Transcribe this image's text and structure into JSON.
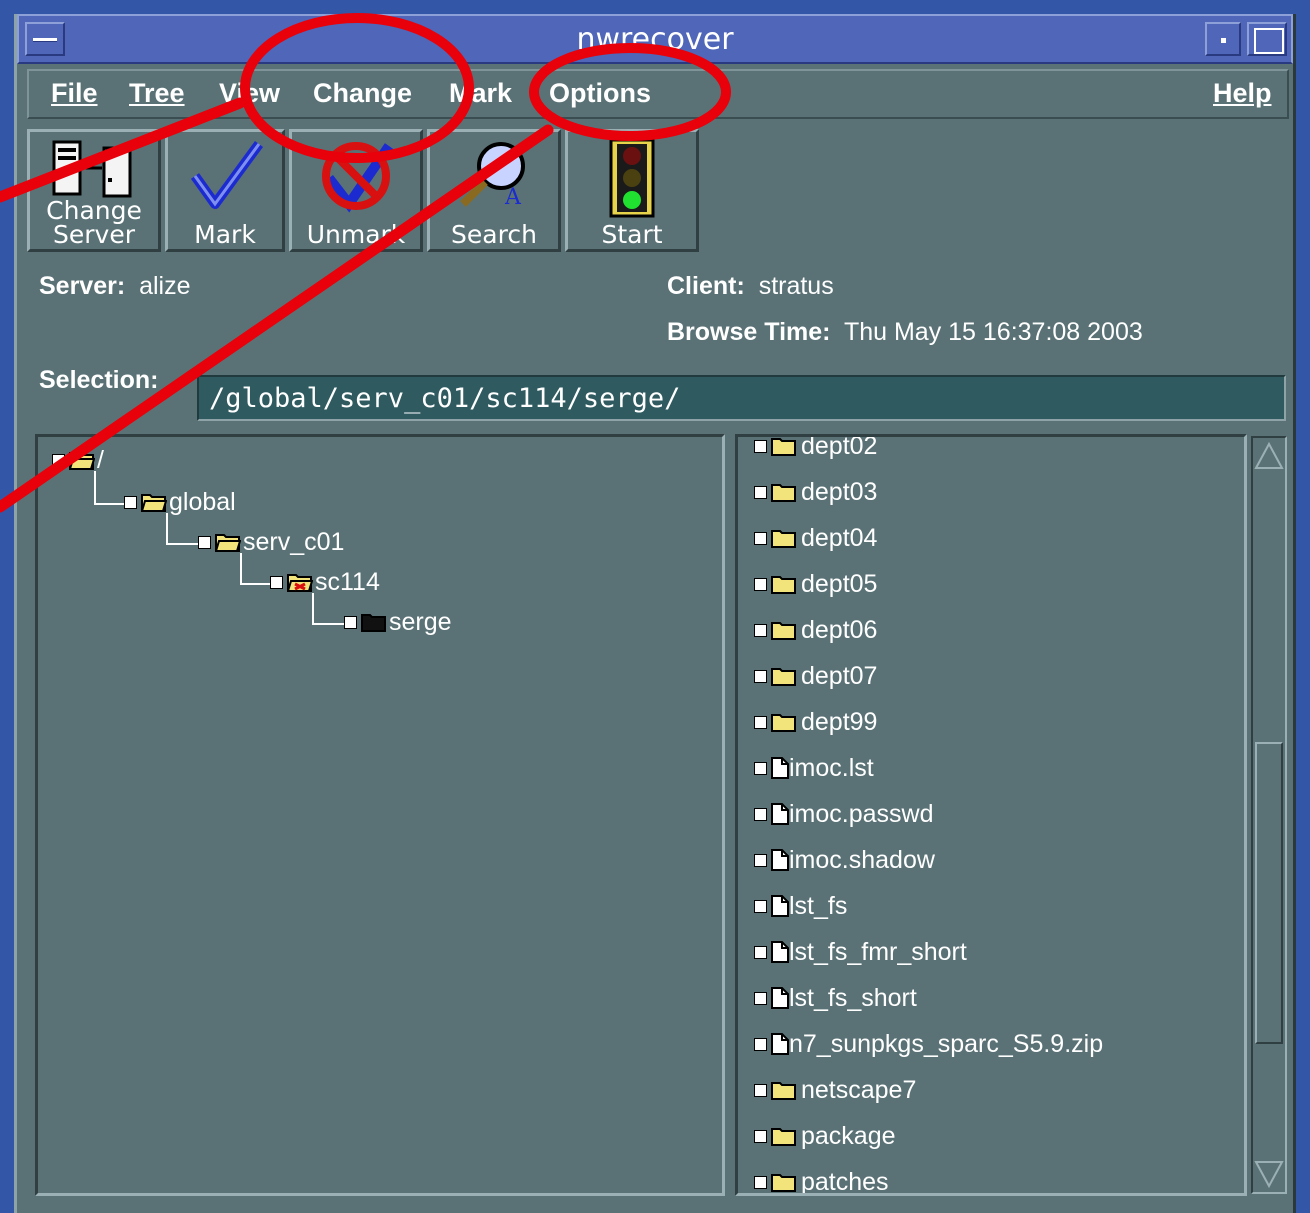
{
  "window": {
    "title": "nwrecover"
  },
  "menubar": {
    "file": "File",
    "tree": "Tree",
    "view": "View",
    "change": "Change",
    "mark": "Mark",
    "options": "Options",
    "help": "Help"
  },
  "toolbar": {
    "change_server_l1": "Change",
    "change_server_l2": "Server",
    "mark": "Mark",
    "unmark": "Unmark",
    "search": "Search",
    "start": "Start"
  },
  "info": {
    "server_label": "Server:",
    "server_value": "alize",
    "client_label": "Client:",
    "client_value": "stratus",
    "browse_label": "Browse Time:",
    "browse_value": "Thu May 15 16:37:08 2003",
    "selection_label": "Selection:",
    "selection_value": "/global/serv_c01/sc114/serge/"
  },
  "tree": [
    "/",
    "global",
    "serv_c01",
    "sc114",
    "serge"
  ],
  "files": [
    {
      "name": "dept02",
      "type": "folder"
    },
    {
      "name": "dept03",
      "type": "folder"
    },
    {
      "name": "dept04",
      "type": "folder"
    },
    {
      "name": "dept05",
      "type": "folder"
    },
    {
      "name": "dept06",
      "type": "folder"
    },
    {
      "name": "dept07",
      "type": "folder"
    },
    {
      "name": "dept99",
      "type": "folder"
    },
    {
      "name": "imoc.lst",
      "type": "file"
    },
    {
      "name": "imoc.passwd",
      "type": "file"
    },
    {
      "name": "imoc.shadow",
      "type": "file"
    },
    {
      "name": "lst_fs",
      "type": "file"
    },
    {
      "name": "lst_fs_fmr_short",
      "type": "file"
    },
    {
      "name": "lst_fs_short",
      "type": "file"
    },
    {
      "name": "n7_sunpkgs_sparc_S5.9.zip",
      "type": "file"
    },
    {
      "name": "netscape7",
      "type": "folder"
    },
    {
      "name": "package",
      "type": "folder"
    },
    {
      "name": "patches",
      "type": "folder"
    }
  ],
  "colors": {
    "annotation": "#e8000a",
    "folder": "#f2e47a",
    "window_bg": "#5a7276",
    "titlebar": "#4f66b9"
  }
}
